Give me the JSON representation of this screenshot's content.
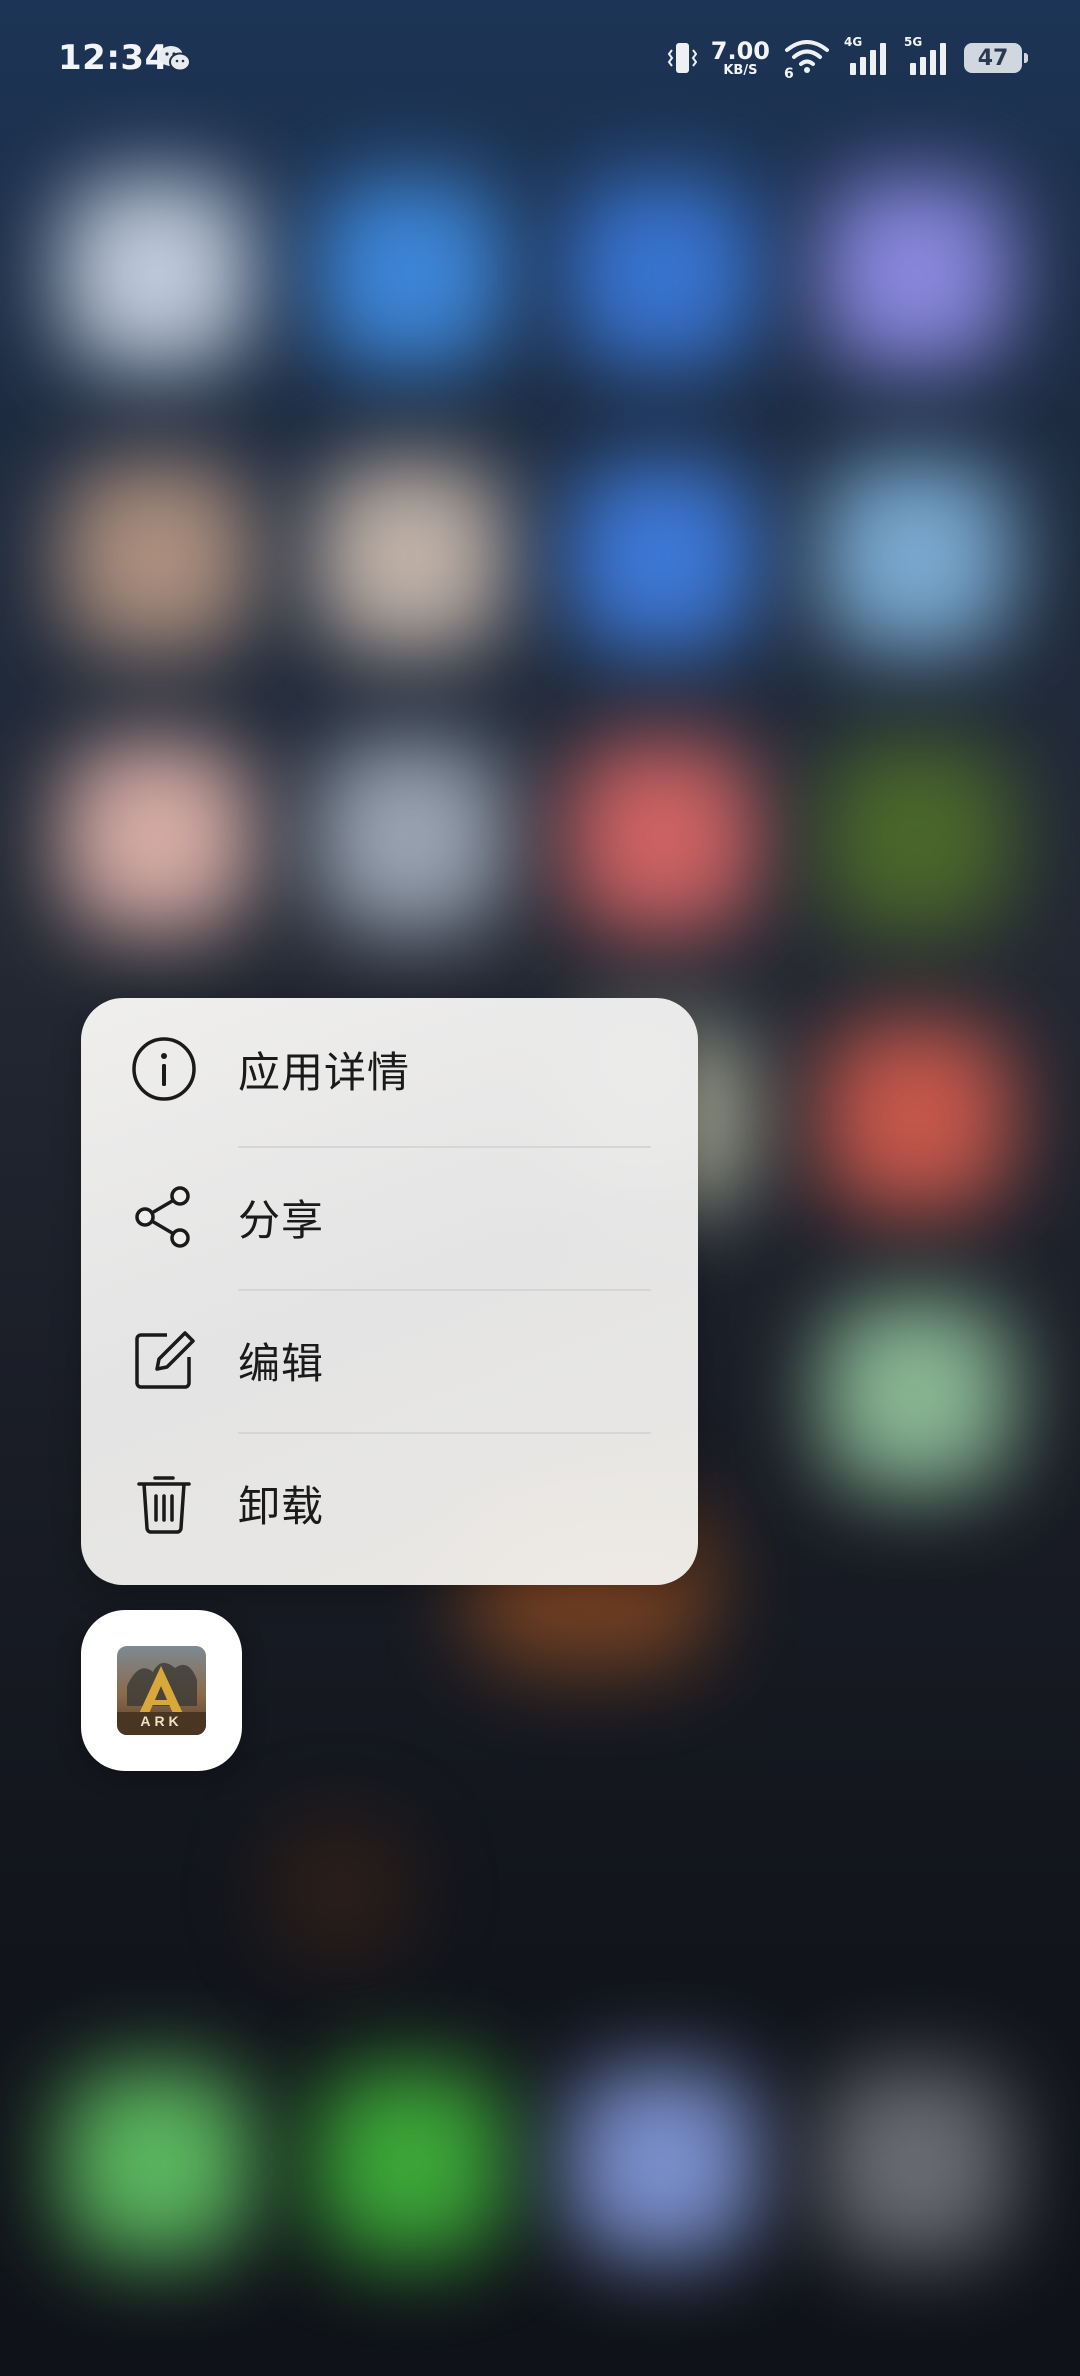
{
  "status_bar": {
    "time": "12:34",
    "net_speed_value": "7.00",
    "net_speed_unit": "KB/S",
    "wifi_sub_label": "6",
    "signal1_label": "4G",
    "signal2_label": "5G",
    "battery_level": "47",
    "icons": [
      "wechat-icon",
      "vibrate-icon",
      "wifi-icon",
      "signal-4g-icon",
      "signal-5g-icon",
      "battery-icon"
    ]
  },
  "context_menu": {
    "items": [
      {
        "label": "应用详情",
        "icon": "info-icon"
      },
      {
        "label": "分享",
        "icon": "share-icon"
      },
      {
        "label": "编辑",
        "icon": "edit-icon"
      },
      {
        "label": "卸载",
        "icon": "trash-icon"
      }
    ]
  },
  "app": {
    "icon": "ark-game-icon",
    "icon_text": "ARK"
  },
  "colors": {
    "menu_background": "#f0efed",
    "menu_text": "#1a1a1a",
    "divider": "#d6d6d6",
    "status_text": "#f2f4f7"
  }
}
